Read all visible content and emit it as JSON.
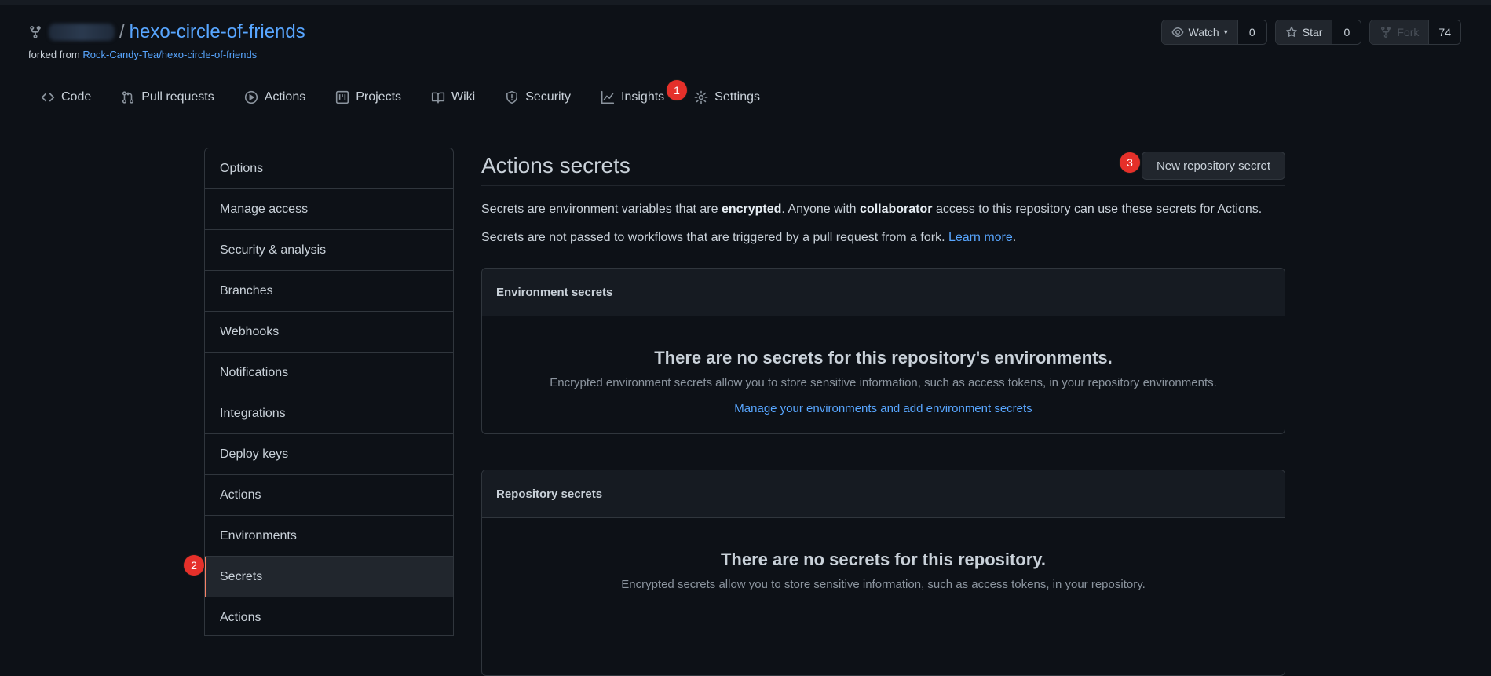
{
  "repo": {
    "name": "hexo-circle-of-friends",
    "separator": "/",
    "forked_from_prefix": "forked from",
    "forked_from_link": "Rock-Candy-Tea/hexo-circle-of-friends"
  },
  "repo_actions": {
    "watch": {
      "label": "Watch",
      "count": "0"
    },
    "star": {
      "label": "Star",
      "count": "0"
    },
    "fork": {
      "label": "Fork",
      "count": "74"
    }
  },
  "tabs": [
    {
      "label": "Code",
      "icon": "code-icon"
    },
    {
      "label": "Pull requests",
      "icon": "pull-request-icon"
    },
    {
      "label": "Actions",
      "icon": "play-icon"
    },
    {
      "label": "Projects",
      "icon": "project-icon"
    },
    {
      "label": "Wiki",
      "icon": "book-icon"
    },
    {
      "label": "Security",
      "icon": "shield-icon"
    },
    {
      "label": "Insights",
      "icon": "graph-icon"
    },
    {
      "label": "Settings",
      "icon": "gear-icon"
    }
  ],
  "badges": {
    "one": "1",
    "two": "2",
    "three": "3"
  },
  "sidebar": {
    "items": [
      "Options",
      "Manage access",
      "Security & analysis",
      "Branches",
      "Webhooks",
      "Notifications",
      "Integrations",
      "Deploy keys",
      "Actions",
      "Environments",
      "Secrets",
      "Actions"
    ],
    "active": "Secrets"
  },
  "main": {
    "title": "Actions secrets",
    "new_secret_button": "New repository secret",
    "desc1": {
      "a": "Secrets are environment variables that are ",
      "b": "encrypted",
      "c": ". Anyone with ",
      "d": "collaborator",
      "e": " access to this repository can use these secrets for Actions."
    },
    "desc2": {
      "a": "Secrets are not passed to workflows that are triggered by a pull request from a fork. ",
      "link": "Learn more",
      "end": "."
    },
    "env_box": {
      "header": "Environment secrets",
      "title": "There are no secrets for this repository's environments.",
      "desc": "Encrypted environment secrets allow you to store sensitive information, such as access tokens, in your repository environments.",
      "link": "Manage your environments and add environment secrets"
    },
    "repo_box": {
      "header": "Repository secrets",
      "title": "There are no secrets for this repository.",
      "desc": "Encrypted secrets allow you to store sensitive information, such as access tokens, in your repository."
    }
  },
  "colors": {
    "background": "#0d1117",
    "link": "#58a6ff",
    "badge": "#e5302a",
    "active_indicator": "#f78166"
  }
}
